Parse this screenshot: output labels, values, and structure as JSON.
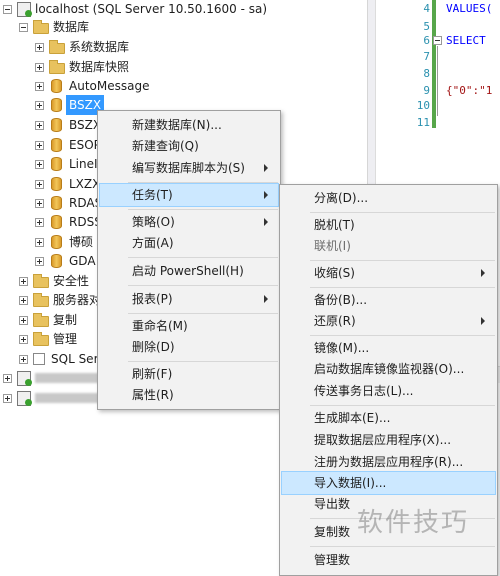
{
  "tree": {
    "server": "localhost (SQL Server 10.50.1600 - sa)",
    "databases": "数据库",
    "system_dbs": "系统数据库",
    "snapshots": "数据库快照",
    "db_items": [
      "AutoMessage",
      "BSZX",
      "BSZX",
      "ESOP",
      "LineI",
      "LXZX",
      "RDAS",
      "RDSS",
      "博硕",
      "GDA"
    ],
    "security": "安全性",
    "server_objects": "服务器对",
    "replication": "复制",
    "management": "管理",
    "sql_server": "SQL Serv",
    "extra_servers": [
      "1",
      "7"
    ]
  },
  "editor": {
    "line_numbers": [
      "4",
      "5",
      "6",
      "7",
      "8",
      "9",
      "10",
      "11"
    ],
    "code_values": "VALUES(",
    "code_select": "SELECT",
    "code_json": "{\"0\":\"1"
  },
  "menu1": {
    "items": [
      "新建数据库(N)...",
      "新建查询(Q)",
      "编写数据库脚本为(S)",
      "任务(T)",
      "策略(O)",
      "方面(A)",
      "启动 PowerShell(H)",
      "报表(P)",
      "重命名(M)",
      "删除(D)",
      "刷新(F)",
      "属性(R)"
    ]
  },
  "menu2": {
    "items": [
      "分离(D)...",
      "脱机(T)",
      "联机(I)",
      "收缩(S)",
      "备份(B)...",
      "还原(R)",
      "镜像(M)...",
      "启动数据库镜像监视器(O)...",
      "传送事务日志(L)...",
      "生成脚本(E)...",
      "提取数据层应用程序(X)...",
      "注册为数据层应用程序(R)...",
      "导入数据(I)...",
      "导出数",
      "复制数",
      "管理数"
    ]
  },
  "watermark": "软件技巧"
}
